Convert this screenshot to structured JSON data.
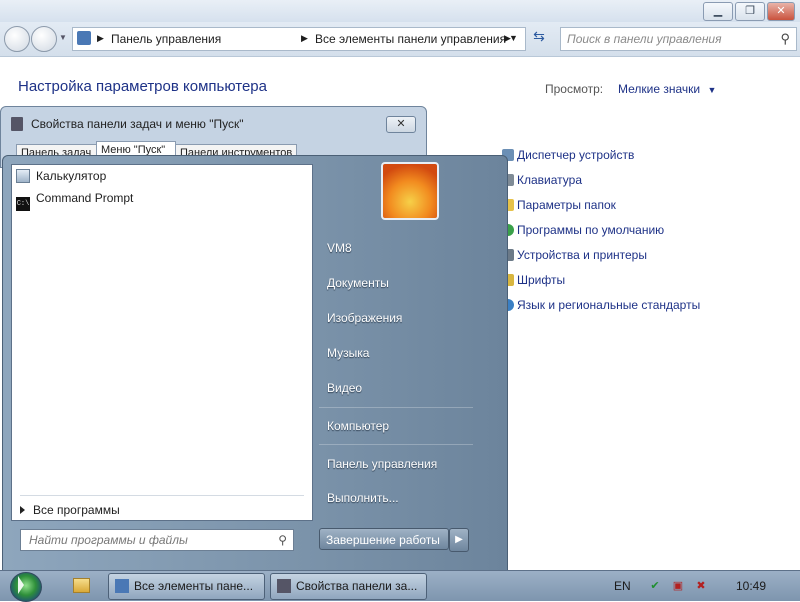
{
  "control_panel": {
    "address_segments": [
      "Панель управления",
      "Все элементы панели управления"
    ],
    "search_placeholder": "Поиск в панели управления",
    "heading": "Настройка параметров компьютера",
    "view_label": "Просмотр:",
    "view_value": "Мелкие значки",
    "items": [
      {
        "label": "Диспетчер устройств",
        "icon": "device-manager-icon",
        "color": "#6b8fb5"
      },
      {
        "label": "Клавиатура",
        "icon": "keyboard-icon",
        "color": "#7f8b96"
      },
      {
        "label": "Параметры папок",
        "icon": "folder-options-icon",
        "color": "#e6c24a"
      },
      {
        "label": "Программы по умолчанию",
        "icon": "default-programs-icon",
        "color": "#3aa04a"
      },
      {
        "label": "Устройства и принтеры",
        "icon": "devices-printers-icon",
        "color": "#6c7a88"
      },
      {
        "label": "Шрифты",
        "icon": "fonts-icon",
        "color": "#d8b640"
      },
      {
        "label": "Язык и региональные стандарты",
        "icon": "globe-icon",
        "color": "#3a7fc4"
      }
    ]
  },
  "taskbar_dialog": {
    "title": "Свойства панели задач и меню \"Пуск\"",
    "close_label": "✕",
    "tabs": [
      "Панель задач",
      "Меню \"Пуск\"",
      "Панели инструментов"
    ]
  },
  "start_menu": {
    "programs": [
      {
        "label": "Калькулятор",
        "icon": "calculator-icon"
      },
      {
        "label": "Command Prompt",
        "icon": "command-prompt-icon"
      }
    ],
    "all_programs": "Все программы",
    "search_placeholder": "Найти программы и файлы",
    "right_items": [
      "VM8",
      "Документы",
      "Изображения",
      "Музыка",
      "Видео",
      "Компьютер",
      "Панель управления",
      "Выполнить..."
    ],
    "shutdown_label": "Завершение работы"
  },
  "taskbar": {
    "items": [
      "Все элементы пане...",
      "Свойства панели за..."
    ],
    "language": "EN",
    "time": "10:49"
  }
}
